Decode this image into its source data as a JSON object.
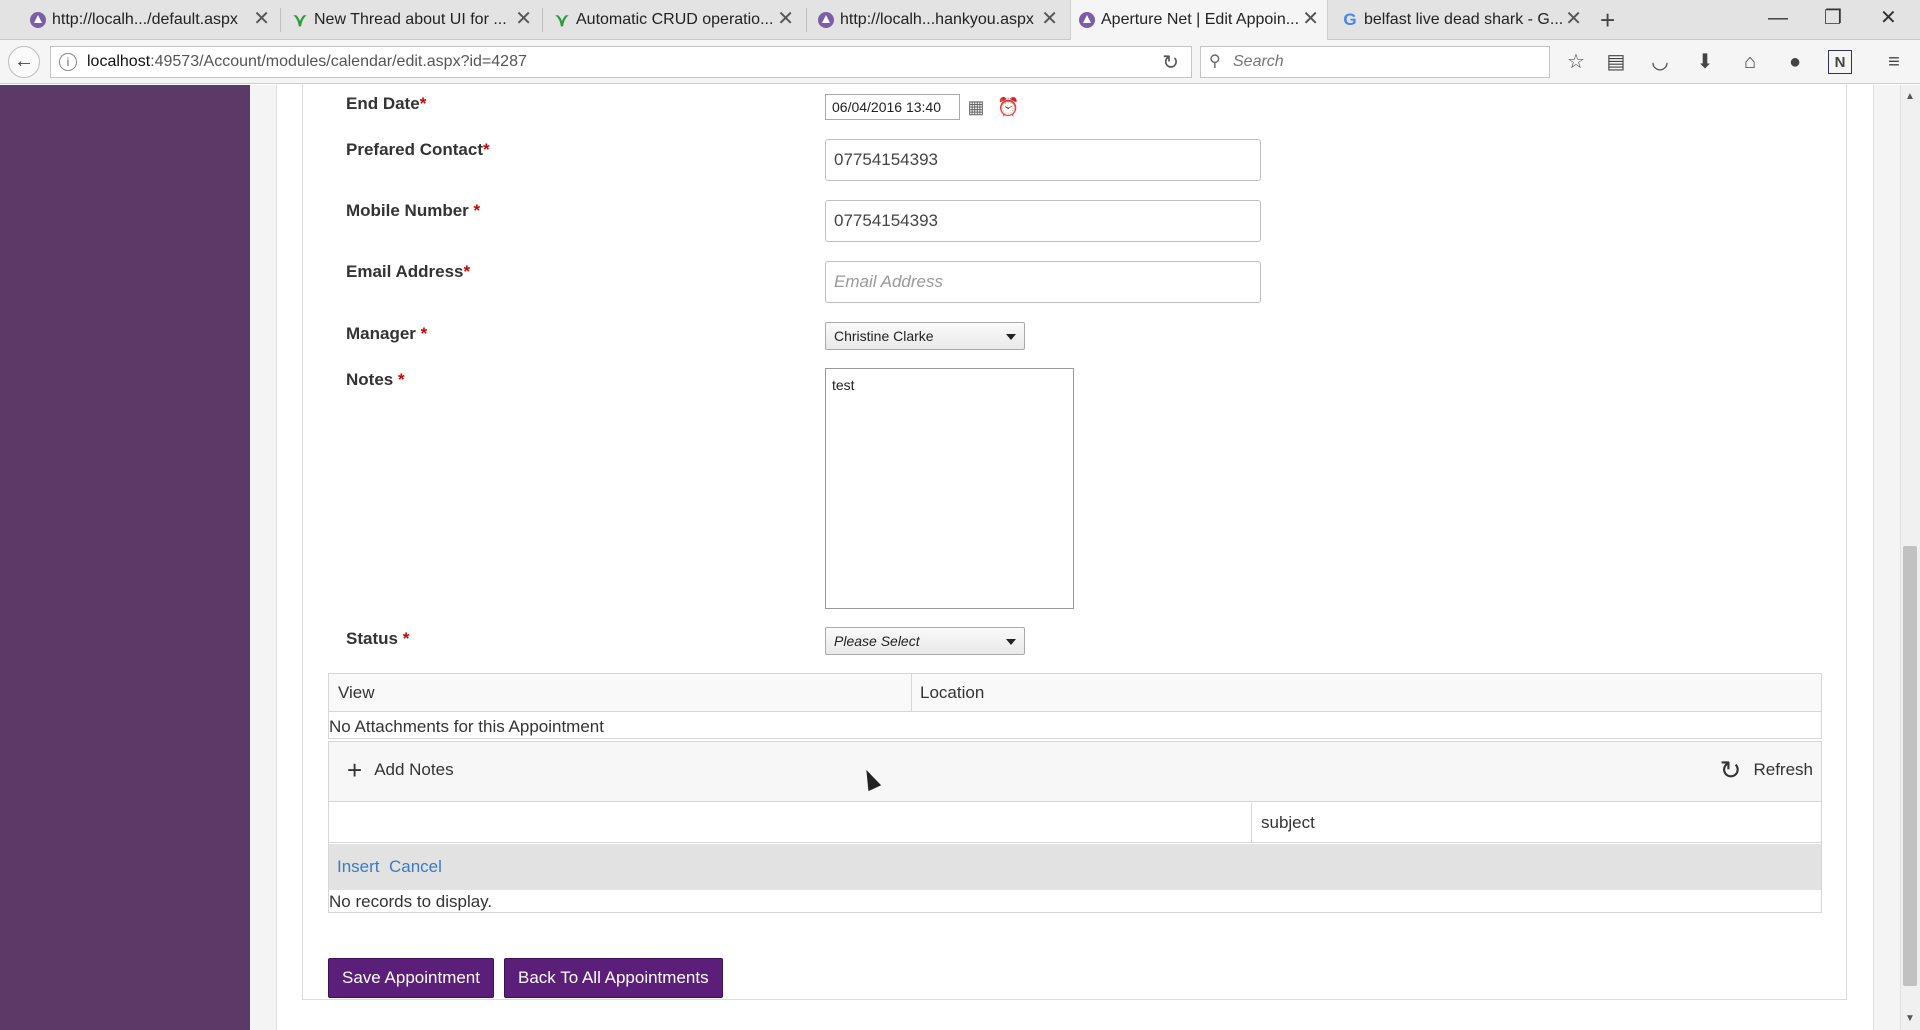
{
  "browser": {
    "tabs": [
      {
        "label": "http://localh.../default.aspx",
        "icon": "aperture-icon"
      },
      {
        "label": "New Thread about UI for ...",
        "icon": "telerik-icon"
      },
      {
        "label": "Automatic CRUD operatio...",
        "icon": "telerik-icon"
      },
      {
        "label": "http://localh...hankyou.aspx",
        "icon": "aperture-icon"
      },
      {
        "label": "Aperture Net | Edit Appoin...",
        "icon": "aperture-icon"
      },
      {
        "label": "belfast live dead shark - G...",
        "icon": "google-icon"
      }
    ],
    "url_host": "localhost",
    "url_rest": ":49573/Account/modules/calendar/edit.aspx?id=4287",
    "search_placeholder": "Search"
  },
  "form": {
    "end_date": {
      "label": "End Date",
      "value": "06/04/2016 13:40"
    },
    "prefered_contact": {
      "label": "Prefared Contact",
      "value": "07754154393"
    },
    "mobile_number": {
      "label": "Mobile Number",
      "value": "07754154393"
    },
    "email_address": {
      "label": "Email Address",
      "placeholder": "Email Address",
      "value": ""
    },
    "manager": {
      "label": "Manager",
      "value": "Christine Clarke"
    },
    "notes": {
      "label": "Notes",
      "value": "test"
    },
    "status": {
      "label": "Status",
      "value": "Please Select"
    },
    "required_marker": "*"
  },
  "attachments": {
    "columns": [
      "View",
      "Location"
    ],
    "empty_text": "No Attachments for this Appointment"
  },
  "notes_grid": {
    "add_label": "Add Notes",
    "refresh_label": "Refresh",
    "columns": [
      "",
      "subject"
    ],
    "insert_label": "Insert",
    "cancel_label": "Cancel",
    "empty_text": "No records to display."
  },
  "actions": {
    "save_label": "Save Appointment",
    "back_label": "Back To All Appointments"
  },
  "colors": {
    "sidebar": "#5b3a68",
    "primary_button": "#5b1f7a",
    "required": "#cc0000",
    "link": "#3b7bbf"
  }
}
